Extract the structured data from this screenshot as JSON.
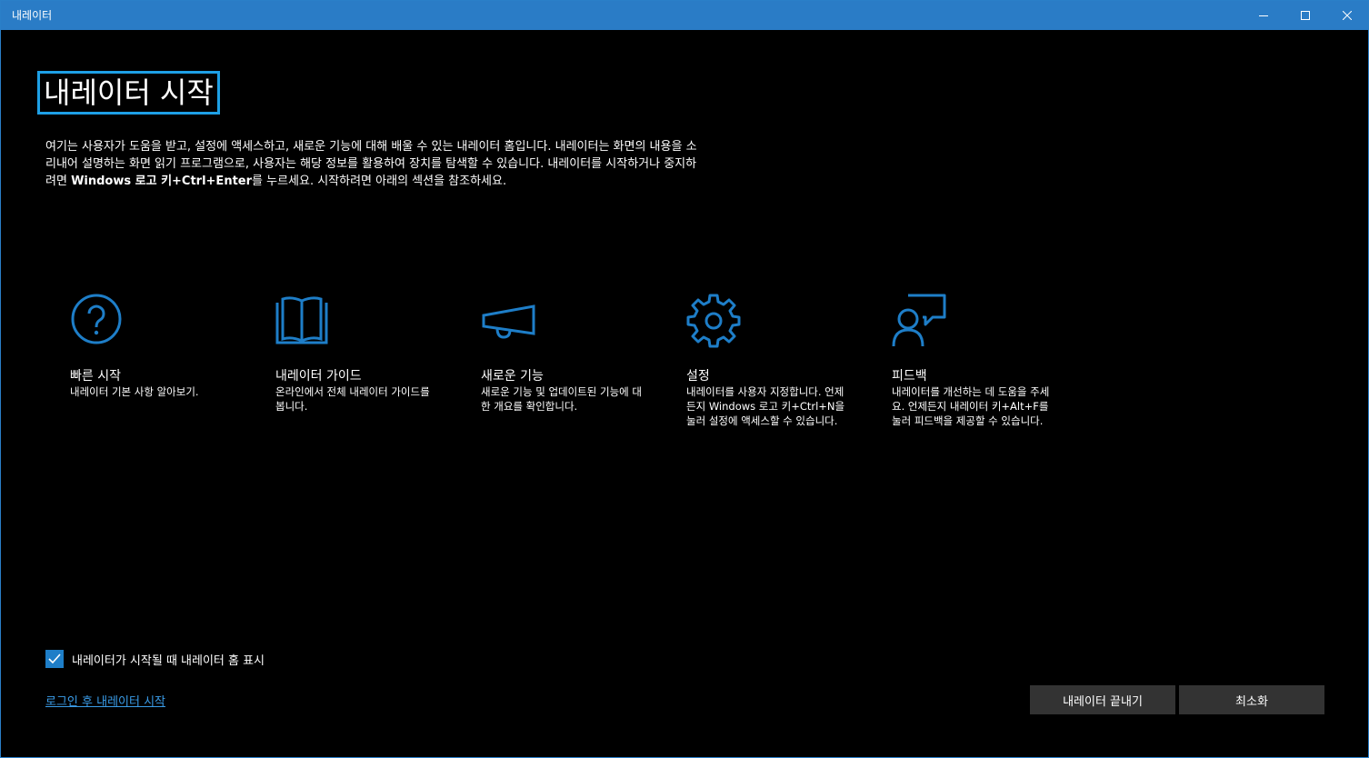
{
  "window": {
    "title": "내레이터",
    "accent": "#2a7cc6"
  },
  "heading": "내레이터 시작",
  "intro": {
    "part1": "여기는 사용자가 도움을 받고, 설정에 액세스하고, 새로운 기능에 대해 배울 수 있는 내레이터 홈입니다. 내레이터는 화면의 내용을 소리내어 설명하는 화면 읽기 프로그램으로, 사용자는 해당 정보를 활용하여 장치를 탐색할 수 있습니다. 내레이터를 시작하거나 중지하려면 ",
    "shortcut": "Windows 로고 키+Ctrl+Enter",
    "part2": "를 누르세요. 시작하려면 아래의 섹션을 참조하세요."
  },
  "cards": [
    {
      "icon": "question-icon",
      "title": "빠른 시작",
      "desc": "내레이터 기본 사항 알아보기."
    },
    {
      "icon": "book-icon",
      "title": "내레이터 가이드",
      "desc": "온라인에서 전체 내레이터 가이드를 봅니다."
    },
    {
      "icon": "megaphone-icon",
      "title": "새로운 기능",
      "desc": "새로운 기능 및 업데이트된 기능에 대한 개요를 확인합니다."
    },
    {
      "icon": "gear-icon",
      "title": "설정",
      "desc": "내레이터를 사용자 지정합니다. 언제든지 Windows 로고 키+Ctrl+N을 눌러 설정에 액세스할 수 있습니다."
    },
    {
      "icon": "feedback-icon",
      "title": "피드백",
      "desc": "내레이터를 개선하는 데 도움을 주세요. 언제든지 내레이터 키+Alt+F를 눌러 피드백을 제공할 수 있습니다."
    }
  ],
  "checkbox": {
    "label": "내레이터가 시작될 때 내레이터 홈 표시",
    "checked": true
  },
  "link": "로그인 후 내레이터 시작",
  "buttons": {
    "exit": "내레이터 끝내기",
    "minimize": "최소화"
  }
}
